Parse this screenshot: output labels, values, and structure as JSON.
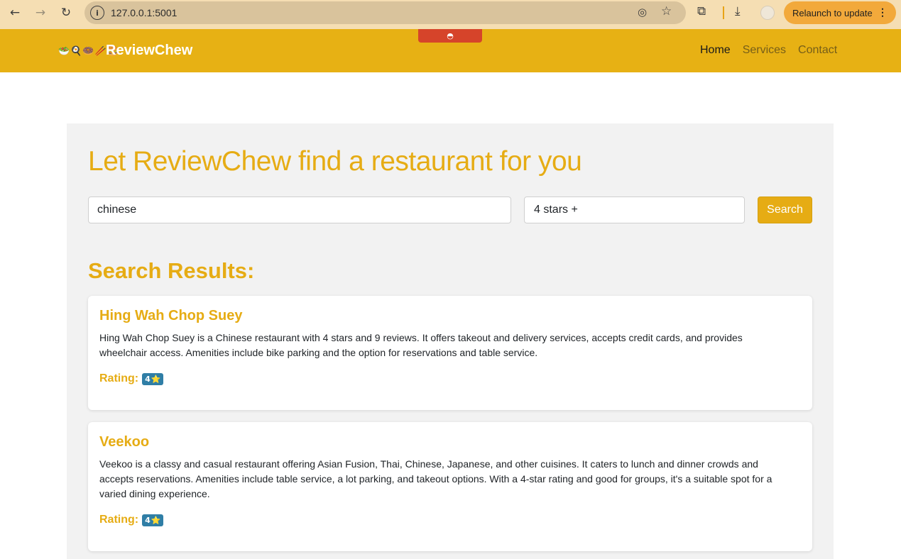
{
  "browser": {
    "back_icon": "←",
    "forward_icon": "→",
    "reload_icon": "↻",
    "info_icon": "i",
    "url": "127.0.0.1:5001",
    "eye_icon": "◎",
    "star_icon": "☆",
    "extensions_icon": "⧉",
    "download_icon": "⤓",
    "relaunch_label": "Relaunch to update",
    "menu_icon": "⋮"
  },
  "navbar": {
    "tab_indicator": "◓",
    "logo_icons": [
      "🥗",
      "🍳",
      "🍩",
      "🥢",
      "🍔"
    ],
    "brand": "ReviewChew",
    "links": [
      {
        "label": "Home",
        "active": true
      },
      {
        "label": "Services",
        "active": false
      },
      {
        "label": "Contact",
        "active": false
      }
    ]
  },
  "main": {
    "headline": "Let ReviewChew find a restaurant for you",
    "search": {
      "query_value": "chinese",
      "rating_value": "4 stars +",
      "button_label": "Search"
    },
    "results_title": "Search Results:",
    "results": [
      {
        "name": "Hing Wah Chop Suey",
        "description": "Hing Wah Chop Suey is a Chinese restaurant with 4 stars and 9 reviews. It offers takeout and delivery services, accepts credit cards, and provides wheelchair access. Amenities include bike parking and the option for reservations and table service.",
        "rating_label": "Rating:",
        "rating_value": "4",
        "rating_star": "⭐"
      },
      {
        "name": "Veekoo",
        "description": "Veekoo is a classy and casual restaurant offering Asian Fusion, Thai, Chinese, Japanese, and other cuisines. It caters to lunch and dinner crowds and accepts reservations. Amenities include table service, a lot parking, and takeout options. With a 4-star rating and good for groups, it's a suitable spot for a varied dining experience.",
        "rating_label": "Rating:",
        "rating_value": "4",
        "rating_star": "⭐"
      }
    ]
  },
  "colors": {
    "brand_yellow": "#e7b114",
    "chrome_bg": "#f5deb3",
    "badge_blue": "#2f7ea6"
  }
}
